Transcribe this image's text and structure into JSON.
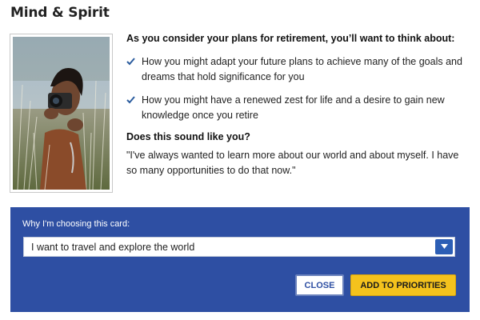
{
  "page": {
    "title": "Mind & Spirit"
  },
  "content": {
    "intro": "As you consider your plans for retirement, you’ll want to think about:",
    "bullets": [
      {
        "icon": "checkmark-icon",
        "text": "How you might adapt your future plans to achieve many of the goals and dreams that hold significance for you"
      },
      {
        "icon": "checkmark-icon",
        "text": "How you might have a renewed zest for life and a desire to gain new knowledge once you retire"
      }
    ],
    "question": "Does this sound like you?",
    "quote": "\"I've always wanted to learn more about our world and about myself. I have so many opportunities to do that now.\""
  },
  "panel": {
    "label": "Why I'm choosing this card:",
    "select_value": "I want to travel and explore the world",
    "close_label": "CLOSE",
    "add_label": "ADD TO PRIORITIES"
  },
  "colors": {
    "panel_bg": "#2e4fa3",
    "accent_button": "#f4c21d",
    "check": "#2b5c9e"
  }
}
